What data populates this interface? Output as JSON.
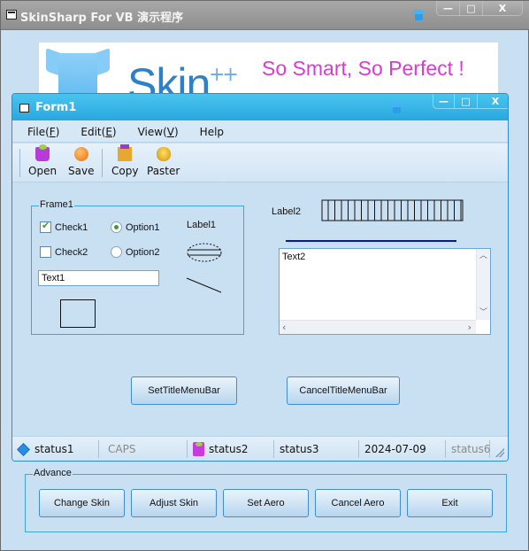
{
  "outer_window": {
    "title": "SkinSharp For VB 演示程序",
    "caption_buttons": {
      "minimize": "—",
      "maximize": "□",
      "close": "X"
    }
  },
  "banner": {
    "logo_text": "Skin",
    "logo_suffix": "++",
    "slogan": "So Smart, So Perfect !"
  },
  "form1": {
    "title": "Form1",
    "caption_buttons": {
      "minimize": "—",
      "maximize": "□",
      "close": "X"
    },
    "menu": [
      {
        "label": "File",
        "accel": "F"
      },
      {
        "label": "Edit",
        "accel": "E"
      },
      {
        "label": "View",
        "accel": "V"
      },
      {
        "label": "Help",
        "accel": ""
      }
    ],
    "toolbar": [
      {
        "label": "Open",
        "icon": "shopping-cart-icon"
      },
      {
        "label": "Save",
        "icon": "orange-ball-icon"
      },
      {
        "label": "Copy",
        "icon": "castle-icon"
      },
      {
        "label": "Paster",
        "icon": "coins-icon"
      }
    ],
    "frame1": {
      "label": "Frame1",
      "check1": {
        "label": "Check1",
        "checked": true
      },
      "check2": {
        "label": "Check2",
        "checked": false
      },
      "option1": {
        "label": "Option1",
        "selected": true
      },
      "option2": {
        "label": "Option2",
        "selected": false
      },
      "label1": "Label1",
      "text1": "Text1"
    },
    "label2": "Label2",
    "text2": "Text2",
    "buttons": {
      "set_title_menubar": "SetTitleMenuBar",
      "cancel_title_menubar": "CancelTitleMenuBar"
    },
    "statusbar": {
      "panels": [
        "status1",
        "CAPS",
        "status2",
        "status3",
        "2024-07-09",
        "status6"
      ]
    }
  },
  "advance": {
    "label": "Advance",
    "buttons": [
      "Change Skin",
      "Adjust Skin",
      "Set Aero",
      "Cancel Aero",
      "Exit"
    ]
  },
  "colors": {
    "form_title": "#28a8e0",
    "accent_border": "#3ea6da",
    "slogan": "#dc3ad0",
    "line_blue": "#0010d8"
  }
}
